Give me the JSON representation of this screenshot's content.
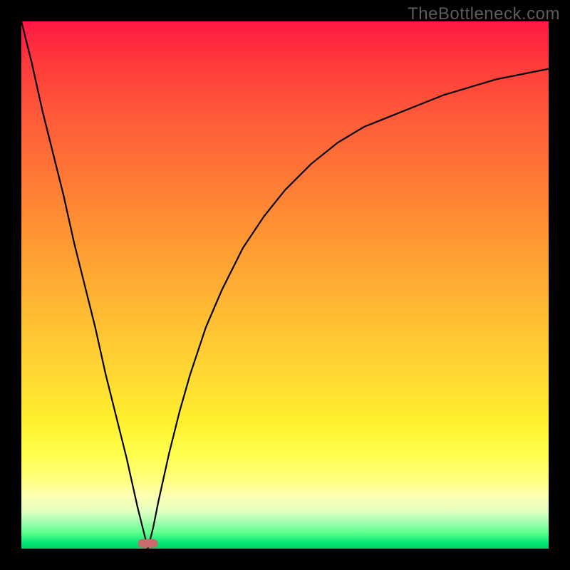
{
  "watermark": "TheBottleneck.com",
  "colors": {
    "frame": "#000000",
    "curve": "#000000",
    "marker": "#c96a6e",
    "gradient_top": "#ff1744",
    "gradient_bottom": "#00d060"
  },
  "chart_data": {
    "type": "line",
    "title": "",
    "subtitle": "",
    "xlabel": "",
    "ylabel": "",
    "xlim": [
      0,
      100
    ],
    "ylim": [
      0,
      100
    ],
    "grid": false,
    "legend": null,
    "marker": {
      "x": 24,
      "y": 1,
      "shape": "rounded-pill"
    },
    "series": [
      {
        "name": "left-branch",
        "x": [
          0,
          2,
          4,
          6,
          8,
          10,
          12,
          14,
          16,
          18,
          20,
          22,
          23,
          24
        ],
        "y": [
          100,
          92,
          83,
          75,
          67,
          58,
          50,
          42,
          33,
          25,
          17,
          8,
          4,
          0
        ]
      },
      {
        "name": "right-branch",
        "x": [
          24,
          25,
          26,
          28,
          30,
          32,
          35,
          38,
          42,
          46,
          50,
          55,
          60,
          65,
          70,
          75,
          80,
          85,
          90,
          95,
          100
        ],
        "y": [
          0,
          4,
          9,
          18,
          26,
          33,
          42,
          49,
          57,
          63,
          68,
          73,
          77,
          80,
          82,
          84,
          86,
          87.5,
          89,
          90,
          91
        ]
      }
    ],
    "annotations": []
  }
}
